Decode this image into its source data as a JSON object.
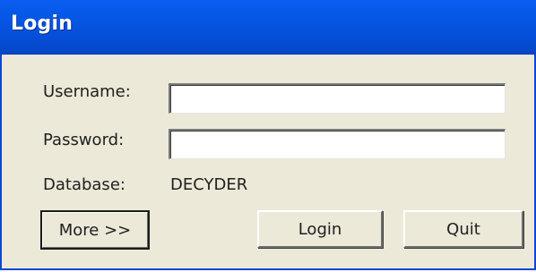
{
  "window": {
    "title": "Login"
  },
  "form": {
    "username_label": "Username:",
    "username_value": "",
    "password_label": "Password:",
    "password_value": "",
    "database_label": "Database:",
    "database_value": "DECYDER"
  },
  "buttons": {
    "more": "More >>",
    "login": "Login",
    "quit": "Quit"
  }
}
